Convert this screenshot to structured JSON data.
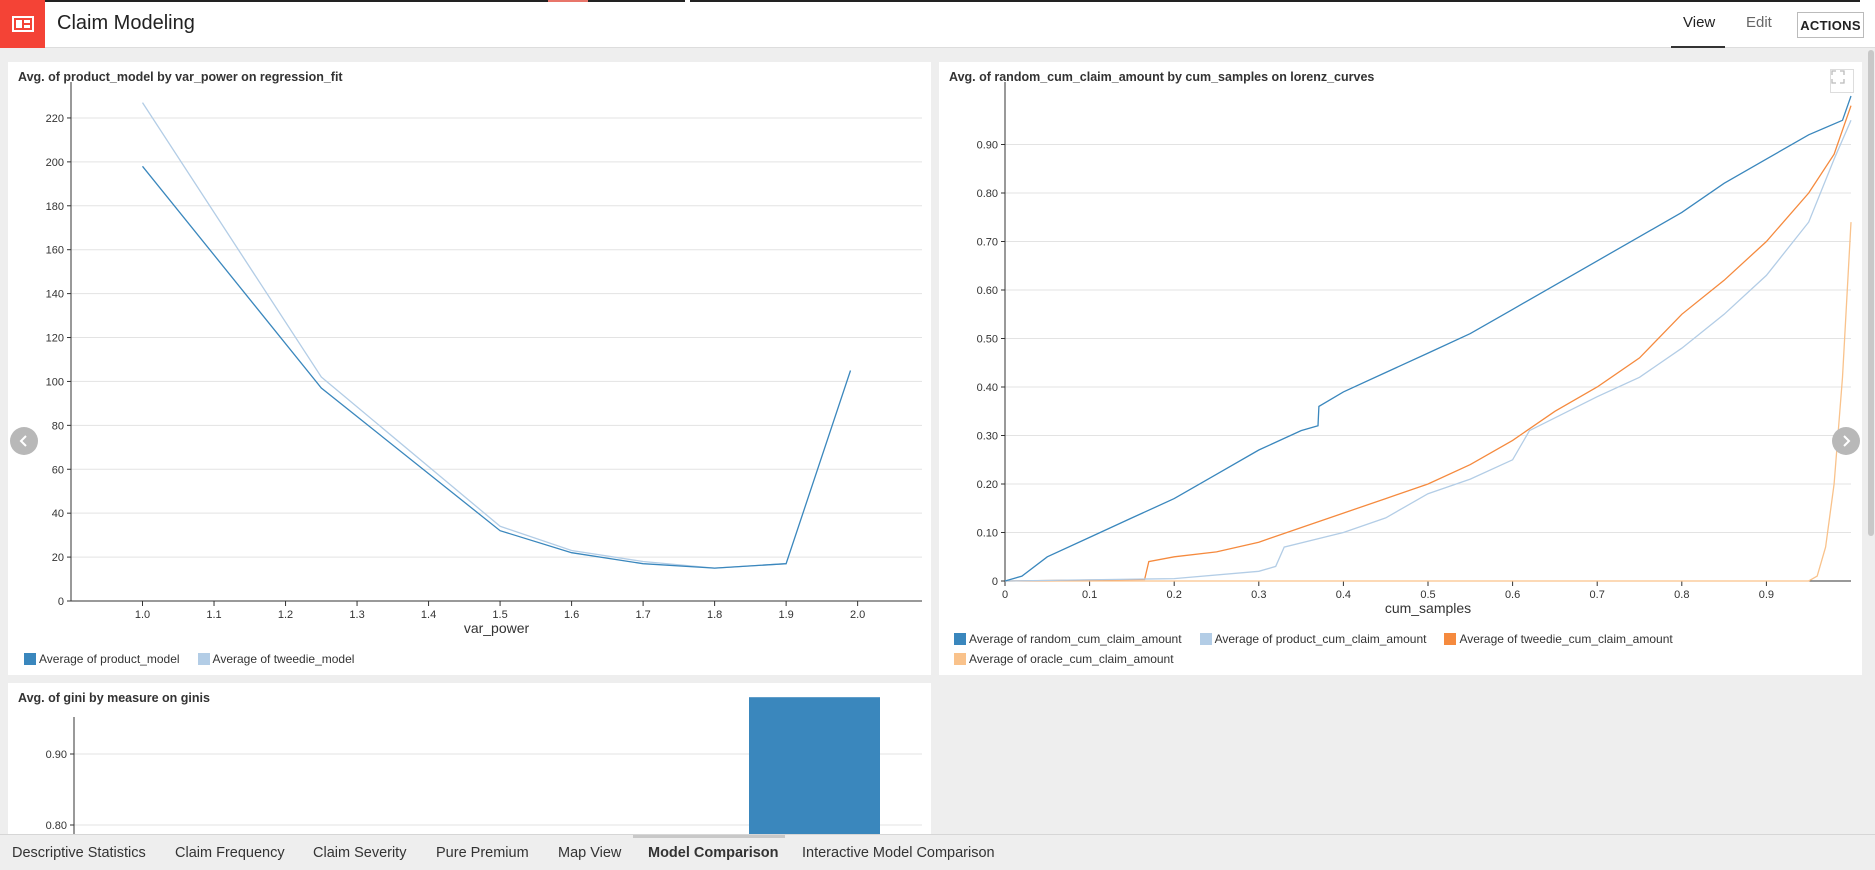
{
  "app": {
    "title": "Claim Modeling"
  },
  "header": {
    "view_label": "View",
    "edit_label": "Edit",
    "actions_label": "ACTIONS"
  },
  "charts": [
    {
      "title": "Avg. of product_model by var_power on regression_fit",
      "xlabel": "var_power",
      "legend": [
        "Average of product_model",
        "Average of tweedie_model"
      ]
    },
    {
      "title": "Avg. of random_cum_claim_amount by cum_samples on lorenz_curves",
      "xlabel": "cum_samples",
      "legend": [
        "Average of random_cum_claim_amount",
        "Average of product_cum_claim_amount",
        "Average of tweedie_cum_claim_amount",
        "Average of oracle_cum_claim_amount"
      ]
    },
    {
      "title": "Avg. of gini by measure on ginis"
    }
  ],
  "chart_data": [
    {
      "type": "line",
      "title": "Avg. of product_model by var_power on regression_fit",
      "xlabel": "var_power",
      "ylabel": "",
      "xticks": [
        "1.0",
        "1.1",
        "1.2",
        "1.3",
        "1.4",
        "1.5",
        "1.6",
        "1.7",
        "1.8",
        "1.9",
        "2.0"
      ],
      "yticks": [
        "0",
        "20",
        "40",
        "60",
        "80",
        "100",
        "120",
        "140",
        "160",
        "180",
        "200",
        "220"
      ],
      "xlim": [
        0.9,
        2.09
      ],
      "ylim": [
        0,
        230
      ],
      "grid": true,
      "legend_position": "bottom-left",
      "series": [
        {
          "name": "Average of product_model",
          "color": "#3a87bd",
          "x": [
            1.0,
            1.25,
            1.5,
            1.6,
            1.7,
            1.8,
            1.9,
            1.99
          ],
          "y": [
            198,
            97,
            32,
            22,
            17,
            15,
            17,
            105
          ]
        },
        {
          "name": "Average of tweedie_model",
          "color": "#b3cde6",
          "x": [
            1.0,
            1.25,
            1.5,
            1.6,
            1.7,
            1.8,
            1.9
          ],
          "y": [
            227,
            102,
            34,
            23,
            18,
            15,
            17
          ]
        }
      ]
    },
    {
      "type": "line",
      "title": "Avg. of random_cum_claim_amount by cum_samples on lorenz_curves",
      "xlabel": "cum_samples",
      "ylabel": "",
      "xticks": [
        "0",
        "0.1",
        "0.2",
        "0.3",
        "0.4",
        "0.5",
        "0.6",
        "0.7",
        "0.8",
        "0.9"
      ],
      "yticks": [
        "0",
        "0.10",
        "0.20",
        "0.30",
        "0.40",
        "0.50",
        "0.60",
        "0.70",
        "0.80",
        "0.90"
      ],
      "xlim": [
        0,
        1.0
      ],
      "ylim": [
        0,
        1.0
      ],
      "grid": true,
      "legend_position": "bottom",
      "series": [
        {
          "name": "Average of random_cum_claim_amount",
          "color": "#3a87bd",
          "x": [
            0,
            0.02,
            0.05,
            0.1,
            0.15,
            0.2,
            0.25,
            0.3,
            0.35,
            0.37,
            0.371,
            0.4,
            0.45,
            0.5,
            0.55,
            0.6,
            0.65,
            0.7,
            0.75,
            0.8,
            0.85,
            0.9,
            0.95,
            0.99,
            1.0
          ],
          "y": [
            0,
            0.01,
            0.05,
            0.09,
            0.13,
            0.17,
            0.22,
            0.27,
            0.31,
            0.32,
            0.36,
            0.39,
            0.43,
            0.47,
            0.51,
            0.56,
            0.61,
            0.66,
            0.71,
            0.76,
            0.82,
            0.87,
            0.92,
            0.95,
            1.0
          ]
        },
        {
          "name": "Average of product_cum_claim_amount",
          "color": "#b3cde6",
          "x": [
            0,
            0.2,
            0.3,
            0.32,
            0.33,
            0.4,
            0.45,
            0.5,
            0.55,
            0.6,
            0.62,
            0.7,
            0.75,
            0.8,
            0.85,
            0.9,
            0.95,
            0.98,
            1.0
          ],
          "y": [
            0,
            0.005,
            0.02,
            0.03,
            0.07,
            0.1,
            0.13,
            0.18,
            0.21,
            0.25,
            0.31,
            0.38,
            0.42,
            0.48,
            0.55,
            0.63,
            0.74,
            0.87,
            0.95
          ]
        },
        {
          "name": "Average of tweedie_cum_claim_amount",
          "color": "#f58a3e",
          "x": [
            0,
            0.1,
            0.165,
            0.17,
            0.2,
            0.25,
            0.3,
            0.35,
            0.4,
            0.45,
            0.5,
            0.55,
            0.6,
            0.65,
            0.7,
            0.75,
            0.8,
            0.85,
            0.9,
            0.95,
            0.98,
            1.0
          ],
          "y": [
            0,
            0.002,
            0.003,
            0.04,
            0.05,
            0.06,
            0.08,
            0.11,
            0.14,
            0.17,
            0.2,
            0.24,
            0.29,
            0.35,
            0.4,
            0.46,
            0.55,
            0.62,
            0.7,
            0.8,
            0.88,
            0.98
          ]
        },
        {
          "name": "Average of oracle_cum_claim_amount",
          "color": "#f9c28b",
          "x": [
            0,
            0.95,
            0.96,
            0.97,
            0.98,
            0.99,
            1.0
          ],
          "y": [
            0,
            0,
            0.01,
            0.07,
            0.2,
            0.42,
            0.74
          ]
        }
      ]
    },
    {
      "type": "bar",
      "title": "Avg. of gini by measure on ginis",
      "yticks": [
        "0.80",
        "0.90"
      ],
      "ylim": [
        0.74,
        0.99
      ],
      "grid": true,
      "bars": [
        {
          "value": 0.98,
          "color": "#3a87bd"
        }
      ]
    }
  ],
  "tabs": [
    {
      "label": "Descriptive Statistics",
      "active": false
    },
    {
      "label": "Claim Frequency",
      "active": false
    },
    {
      "label": "Claim Severity",
      "active": false
    },
    {
      "label": "Pure Premium",
      "active": false
    },
    {
      "label": "Map View",
      "active": false
    },
    {
      "label": "Model Comparison",
      "active": true
    },
    {
      "label": "Interactive Model Comparison",
      "active": false
    }
  ]
}
